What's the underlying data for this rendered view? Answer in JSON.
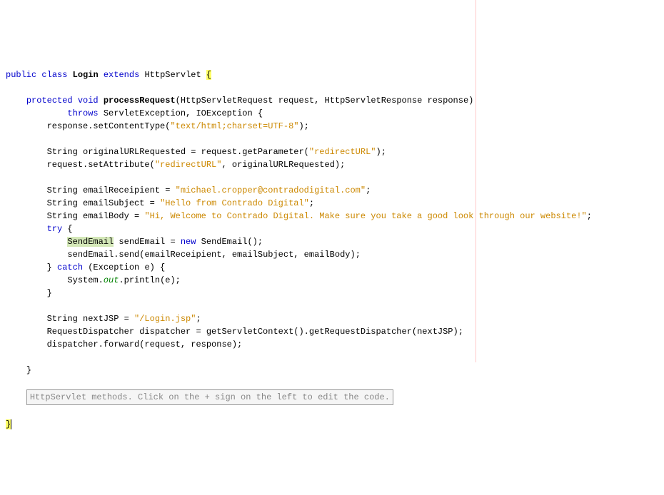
{
  "code": {
    "kw_public": "public",
    "kw_class": "class",
    "cls_Login": "Login",
    "kw_extends": "extends",
    "cls_HttpServlet": "HttpServlet",
    "brace_open": "{",
    "brace_close": "}",
    "kw_protected": "protected",
    "kw_void": "void",
    "m_processRequest": "processRequest",
    "sig_params": "(HttpServletRequest request, HttpServletResponse response)",
    "kw_throws": "throws",
    "throws_list": "ServletException, IOException {",
    "l_setContentType_a": "response.setContentType(",
    "s_contenttype": "\"text/html;charset=UTF-8\"",
    "l_setContentType_b": ");",
    "l_orig_a": "String originalURLRequested = request.getParameter(",
    "s_redirectURL": "\"redirectURL\"",
    "l_orig_b": ");",
    "l_setAttr_a": "request.setAttribute(",
    "l_setAttr_b": ", originalURLRequested);",
    "l_recip_a": "String emailReceipient = ",
    "s_recip": "\"michael.cropper@contradodigital.com\"",
    "semi": ";",
    "l_subj_a": "String emailSubject = ",
    "s_subj": "\"Hello from Contrado Digital\"",
    "l_body_a": "String emailBody = ",
    "s_body": "\"Hi, Welcome to Contrado Digital. Make sure you take a good look through our website!\"",
    "kw_try": "try",
    "SendEmail": "SendEmail",
    "l_se_decl": " sendEmail = ",
    "kw_new": "new",
    "l_se_ctor": " SendEmail();",
    "l_se_send": "sendEmail.send(emailReceipient, emailSubject, emailBody);",
    "kw_catch": "catch",
    "l_catch_params": " (Exception e) {",
    "l_sout_a": "System.",
    "italic_out": "out",
    "l_sout_b": ".println(e);",
    "l_nextjsp_a": "String nextJSP = ",
    "s_nextjsp": "\"/Login.jsp\"",
    "l_dispatcher": "RequestDispatcher dispatcher = getServletContext().getRequestDispatcher(nextJSP);",
    "l_forward": "dispatcher.forward(request, response);",
    "folded_text": "HttpServlet methods. Click on the + sign on the left to edit the code."
  }
}
